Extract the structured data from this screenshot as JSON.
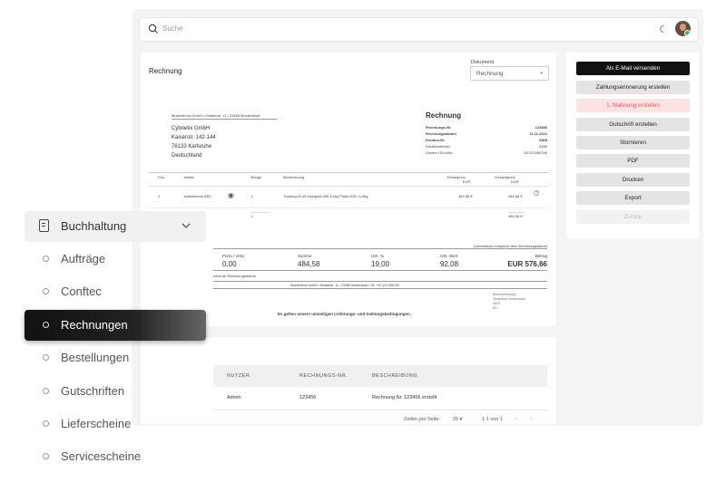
{
  "search": {
    "placeholder": "Suche"
  },
  "invoice": {
    "title": "Rechnung",
    "dokument_label": "Dokument",
    "dokument_value": "Rechnung",
    "sender_line": "Musterfirma GmbH • Musterstr. 11 • 23456 Musterstadt",
    "recipient": [
      "Cybnetix GmbH",
      "Kaiserstr. 142-144",
      "76133 Karlsruhe",
      "Deutschland"
    ],
    "heading": "Rechnung",
    "meta": [
      {
        "k": "Rechnungs-Nr.",
        "v": "123456"
      },
      {
        "k": "Rechnungsdatum",
        "v": "11.11.2022"
      },
      {
        "k": "Kunden-Nr.",
        "v": "6868"
      },
      {
        "k": "Sachbearbeiter",
        "v": "ADM"
      },
      {
        "k": "Unsere USt-IdNr.",
        "v": "DE123456789"
      }
    ],
    "table_head": {
      "pos": "Pos.",
      "artikel": "Artikel",
      "menge": "Menge",
      "bez": "Bezeichnung",
      "einzel": "Einzelpreis",
      "einzel_unit": "EUR",
      "gesamt": "Gesamtpreis",
      "gesamt_unit": "EUR"
    },
    "row": {
      "pos": "1",
      "artikel": "Artikelname ABC",
      "menge": "1",
      "bez": "Trauring W 45 Zweigold 585 3,4kg Platin 600/- 6,49g",
      "einzel": "484,58 €",
      "gesamt": "484,58 €"
    },
    "row2": {
      "menge": "1",
      "gesamt": "484,58 €"
    },
    "lieferdatum_note": "Lieferdatum entspricht dem Rechnungsdatum",
    "totals_head": {
      "porto": "Porto / Verp.",
      "summe": "Summe",
      "ust_pct": "USt. %",
      "ust_wert": "USt. Wert",
      "betrag": "Betrag"
    },
    "totals": {
      "porto": "0,00",
      "summe": "484,58",
      "ust_pct": "19,00",
      "ust_wert": "92,08",
      "betrag": "EUR 576,66"
    },
    "netto_note": "netto ab Rechnungsdatum",
    "footer_line": "Musterfirma GmbH • Musterstr. 11 • 23456 Musterstadt • Tel. +49 123 456789",
    "bank": [
      "Bankverbindung",
      "Sparkasse Musterstadt",
      "IBAN",
      "BIC"
    ],
    "terms": "Es gelten unsere umseitigen Lieferungs- und Zahlungsbedingungen."
  },
  "actions": {
    "email": "Als E-Mail versenden",
    "erinnerung": "Zahlungserinnerung erstellen",
    "mahnung": "1. Mahnung erstellen",
    "gutschrift": "Gutschrift erstellen",
    "stornieren": "Stornieren",
    "pdf": "PDF",
    "drucken": "Drucken",
    "export": "Export",
    "zurueck": "Zurück"
  },
  "log": {
    "col_nutzer": "NUTZER",
    "col_nr": "RECHNUNGS-NR.",
    "col_beschreibung": "BESCHREIBUNG",
    "row": {
      "nutzer": "Admin",
      "nr": "123456",
      "beschreibung": "Rechnung Nr. 123456 erstellt"
    },
    "pager": {
      "rows_label": "Zeilen pro Seite:",
      "rows_value": "25",
      "range": "1-1 von 1",
      "prev": "‹",
      "next": "›"
    }
  },
  "sidebar": {
    "group": "Buchhaltung",
    "items": [
      "Aufträge",
      "Conftec",
      "Rechnungen",
      "Bestellungen",
      "Gutschriften",
      "Lieferscheine",
      "Servicescheine"
    ],
    "active_index": 2
  }
}
